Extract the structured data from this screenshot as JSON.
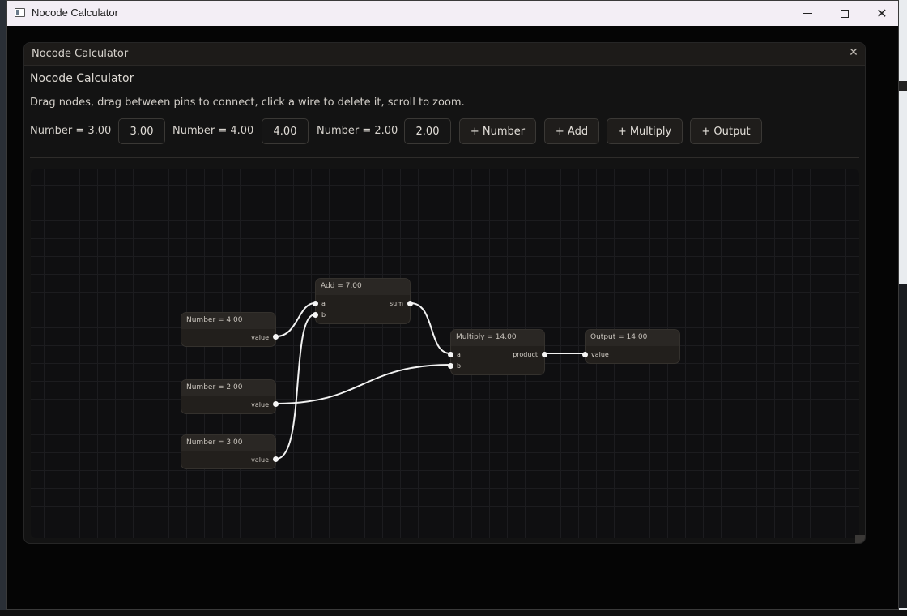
{
  "os_window": {
    "title": "Nocode Calculator"
  },
  "app": {
    "panel_title": "Nocode Calculator",
    "heading": "Nocode Calculator",
    "subtitle": "Drag nodes, drag between pins to connect, click a wire to delete it, scroll to zoom."
  },
  "toolbar": {
    "number_fields": [
      {
        "label": "Number = 3.00",
        "value": "3.00"
      },
      {
        "label": "Number = 4.00",
        "value": "4.00"
      },
      {
        "label": "Number = 2.00",
        "value": "2.00"
      }
    ],
    "buttons": {
      "add_number": "+ Number",
      "add_add": "+ Add",
      "add_multiply": "+ Multiply",
      "add_output": "+ Output"
    }
  },
  "graph": {
    "nodes": {
      "number_4": {
        "title": "Number = 4.00",
        "output_pin": "value"
      },
      "number_2": {
        "title": "Number = 2.00",
        "output_pin": "value"
      },
      "number_3": {
        "title": "Number = 3.00",
        "output_pin": "value"
      },
      "add": {
        "title": "Add = 7.00",
        "input_a": "a",
        "input_b": "b",
        "output_pin": "sum"
      },
      "multiply": {
        "title": "Multiply = 14.00",
        "input_a": "a",
        "input_b": "b",
        "output_pin": "product"
      },
      "output": {
        "title": "Output = 14.00",
        "input_pin": "value"
      }
    },
    "wires": [
      {
        "from": "number_4.value",
        "to": "add.a"
      },
      {
        "from": "number_3.value",
        "to": "add.b"
      },
      {
        "from": "add.sum",
        "to": "multiply.a"
      },
      {
        "from": "number_2.value",
        "to": "multiply.b"
      },
      {
        "from": "multiply.product",
        "to": "output.value"
      }
    ],
    "wire_color": "#f2f2f2"
  },
  "colors": {
    "panel_bg": "#131313",
    "node_bg": "#221f1c",
    "titlebar_bg": "#f3eef5"
  }
}
